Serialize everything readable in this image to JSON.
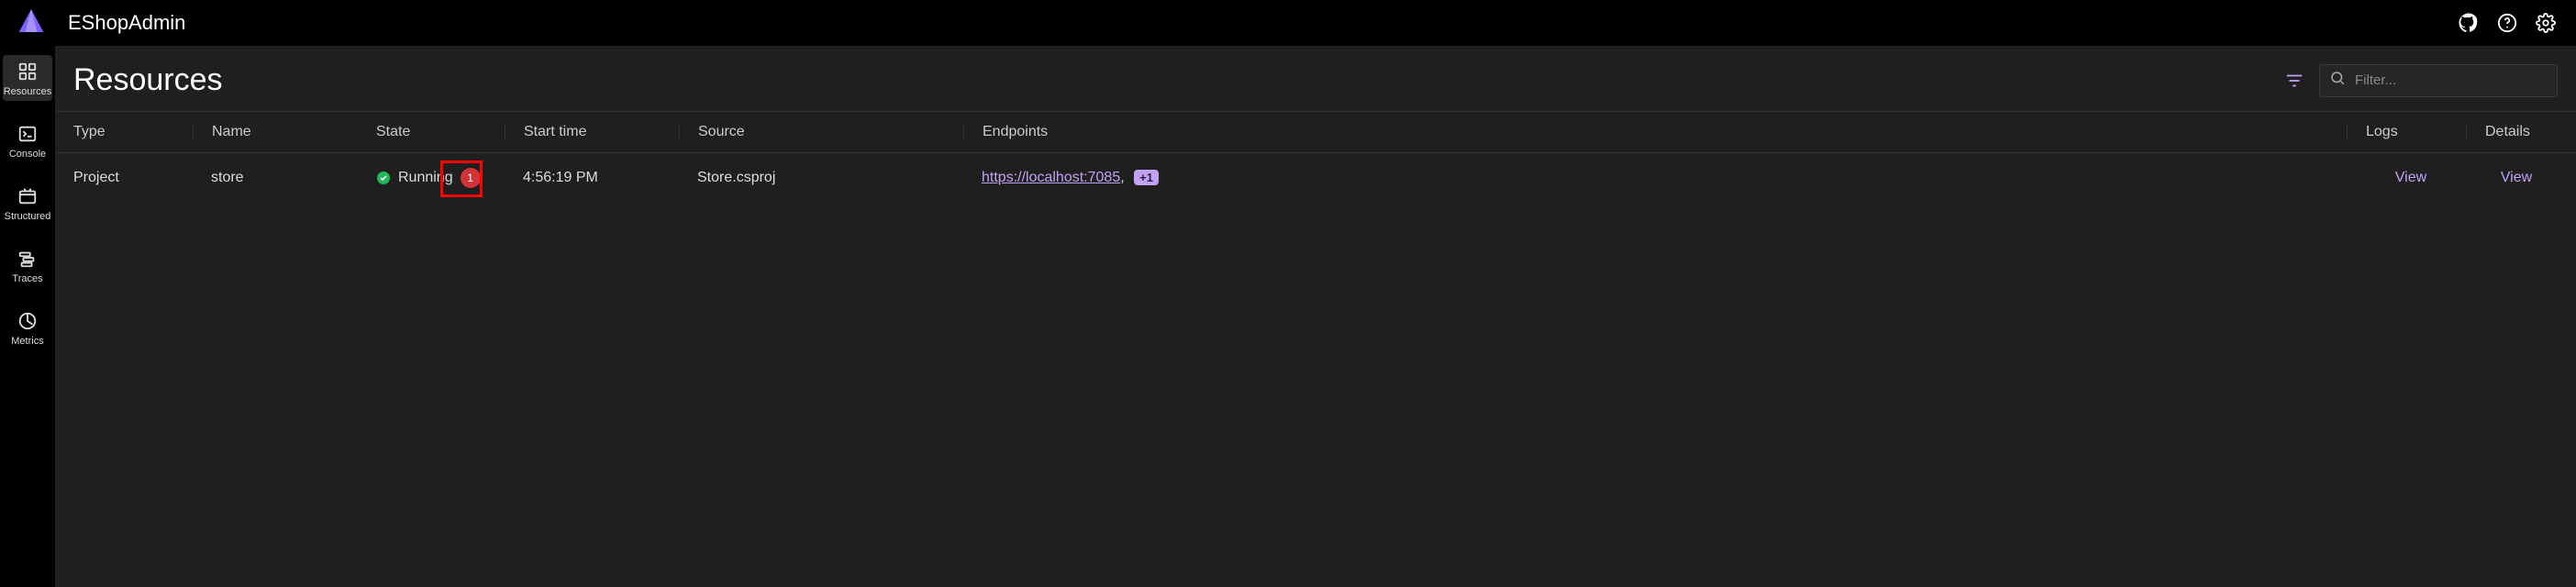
{
  "header": {
    "app_title": "EShopAdmin"
  },
  "sidebar": {
    "items": [
      {
        "label": "Resources"
      },
      {
        "label": "Console"
      },
      {
        "label": "Structured"
      },
      {
        "label": "Traces"
      },
      {
        "label": "Metrics"
      }
    ]
  },
  "main": {
    "page_title": "Resources",
    "search": {
      "placeholder": "Filter..."
    },
    "columns": {
      "type": "Type",
      "name": "Name",
      "state": "State",
      "start_time": "Start time",
      "source": "Source",
      "endpoints": "Endpoints",
      "logs": "Logs",
      "details": "Details"
    },
    "row": {
      "type": "Project",
      "name": "store",
      "state": "Running",
      "state_badge_count": "1",
      "start_time": "4:56:19 PM",
      "source": "Store.csproj",
      "endpoint_url_text": "https://localhost:7085",
      "endpoint_comma": ",",
      "endpoint_badge": "+1",
      "logs_link": "View",
      "details_link": "View"
    }
  },
  "colors": {
    "accent": "#c2a2f6",
    "danger": "#d13438",
    "success": "#1db954"
  }
}
